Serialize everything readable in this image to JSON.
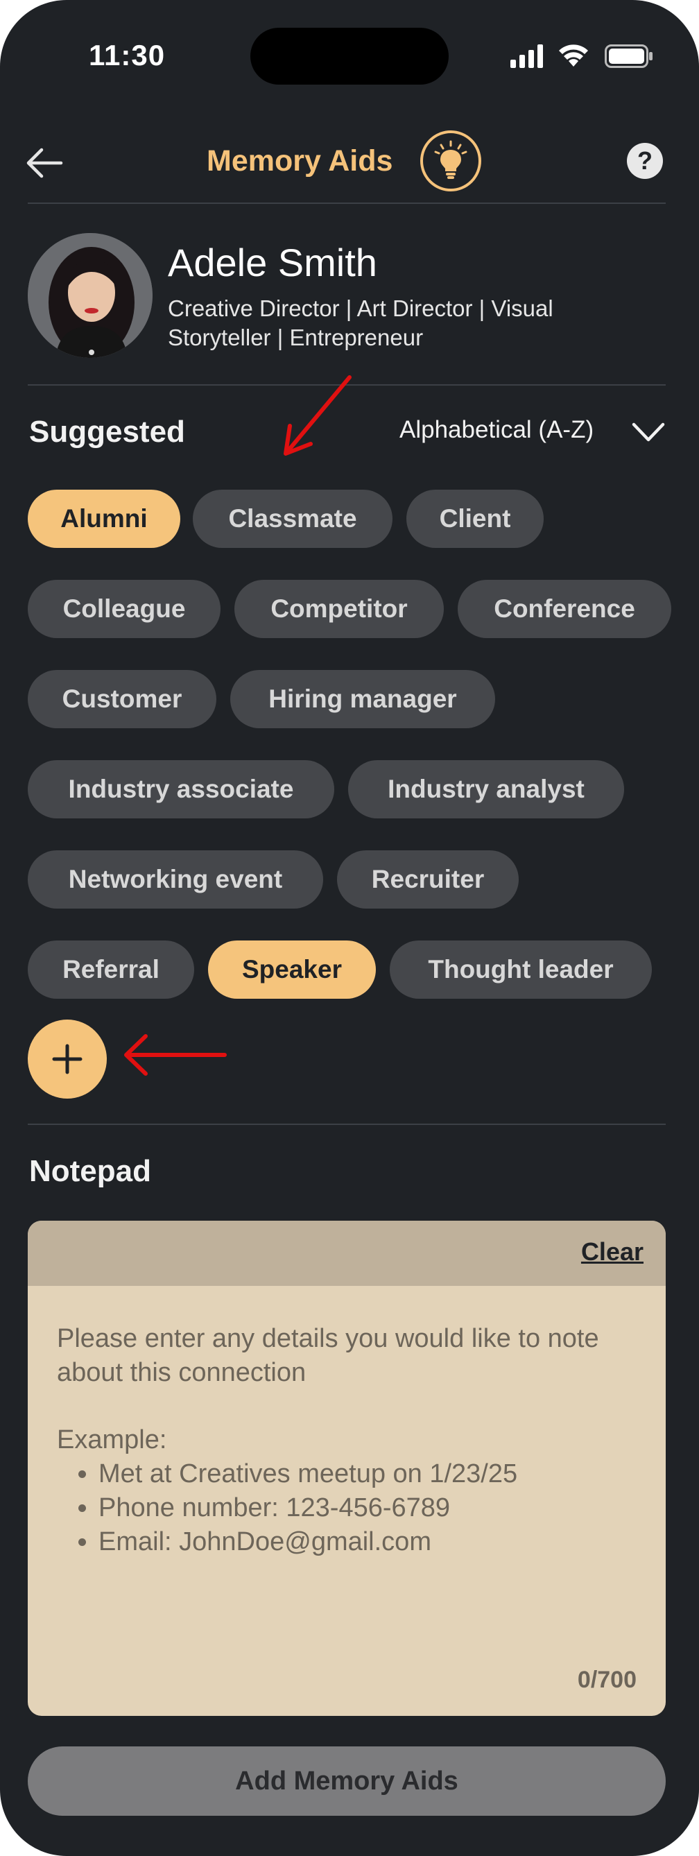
{
  "status_bar": {
    "time": "11:30"
  },
  "header": {
    "title": "Memory Aids",
    "icons": [
      "back-arrow-icon",
      "lightbulb-icon",
      "help-icon"
    ],
    "help_glyph": "?"
  },
  "profile": {
    "name": "Adele Smith",
    "subtitle": "Creative Director | Art Director | Visual Storyteller | Entrepreneur"
  },
  "suggested": {
    "title": "Suggested",
    "sort_label": "Alphabetical (A-Z)",
    "chips": [
      {
        "label": "Alumni",
        "selected": true
      },
      {
        "label": "Classmate",
        "selected": false
      },
      {
        "label": "Client",
        "selected": false
      },
      {
        "label": "Colleague",
        "selected": false
      },
      {
        "label": "Competitor",
        "selected": false
      },
      {
        "label": "Conference",
        "selected": false
      },
      {
        "label": "Customer",
        "selected": false
      },
      {
        "label": "Hiring manager",
        "selected": false
      },
      {
        "label": "Industry associate",
        "selected": false
      },
      {
        "label": "Industry analyst",
        "selected": false
      },
      {
        "label": "Networking event",
        "selected": false
      },
      {
        "label": "Recruiter",
        "selected": false
      },
      {
        "label": "Referral",
        "selected": false
      },
      {
        "label": "Speaker",
        "selected": true
      },
      {
        "label": "Thought leader",
        "selected": false
      }
    ]
  },
  "notepad": {
    "title": "Notepad",
    "clear_label": "Clear",
    "placeholder_intro": "Please enter any details you would like to note about this connection",
    "placeholder_example_label": "Example:",
    "placeholder_examples": [
      "Met at Creatives meetup on 1/23/25",
      "Phone number: 123-456-6789",
      "Email: JohnDoe@gmail.com"
    ],
    "counter": "0/700"
  },
  "actions": {
    "submit_label": "Add Memory Aids"
  },
  "colors": {
    "background": "#1f2226",
    "accent": "#f5c47c",
    "chip": "#45474b",
    "notepad": "#e3d3b8",
    "annotation_arrow": "#e01010"
  }
}
